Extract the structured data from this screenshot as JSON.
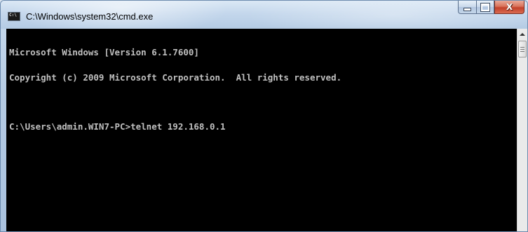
{
  "window": {
    "title": "C:\\Windows\\system32\\cmd.exe",
    "icon": "cmd-prompt-icon",
    "icon_text": "C:\\"
  },
  "caption_buttons": {
    "minimize_icon": "minimize-icon",
    "maximize_icon": "maximize-icon",
    "close_icon": "close-icon",
    "close_glyph": "X"
  },
  "console": {
    "background": "#000000",
    "text_color": "#c0c0c0",
    "lines": [
      "Microsoft Windows [Version 6.1.7600]",
      "Copyright (c) 2009 Microsoft Corporation.  All rights reserved.",
      "",
      "C:\\Users\\admin.WIN7-PC>telnet 192.168.0.1"
    ]
  },
  "colors": {
    "close_button": "#c2412a",
    "titlebar": "#c4d7ec"
  }
}
